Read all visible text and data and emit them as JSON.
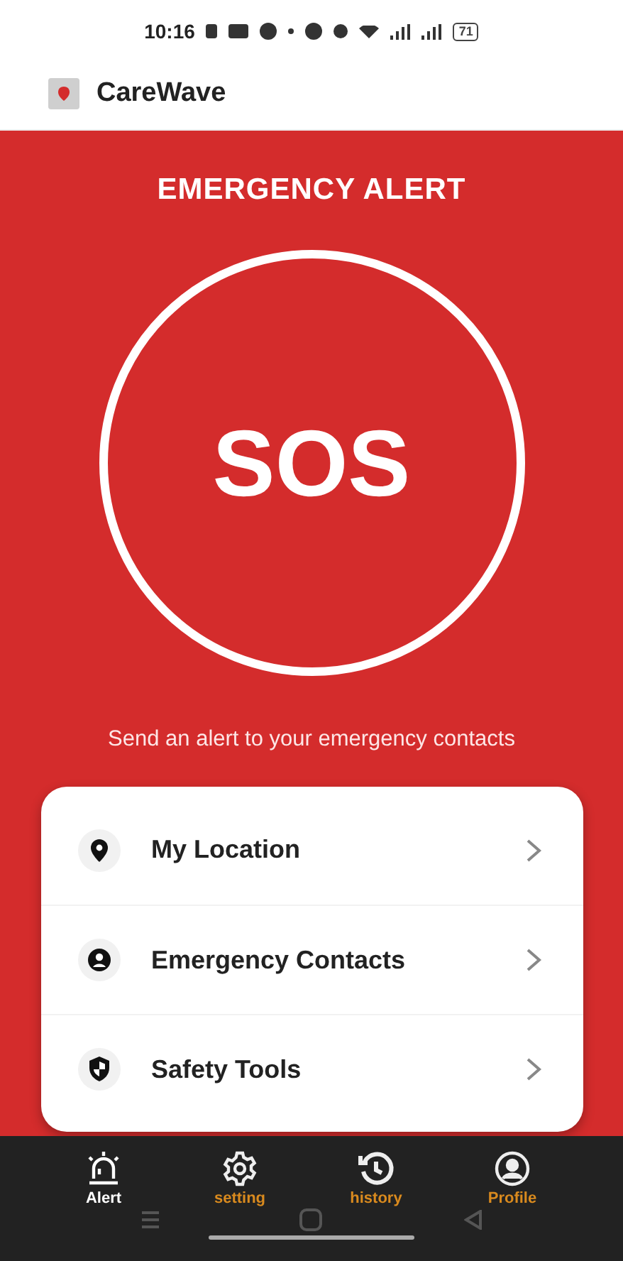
{
  "status_bar": {
    "time": "10:16",
    "battery": "71"
  },
  "app_bar": {
    "title": "CareWave"
  },
  "alert": {
    "title": "EMERGENCY ALERT",
    "button": "SOS",
    "caption": "Send an alert to your emergency contacts"
  },
  "menu": [
    {
      "kind": "location",
      "label": "My Location"
    },
    {
      "kind": "contacts",
      "label": "Emergency Contacts"
    },
    {
      "kind": "tools",
      "label": "Safety Tools"
    }
  ],
  "nav": [
    {
      "kind": "alert",
      "label": "Alert",
      "selected": true
    },
    {
      "kind": "setting",
      "label": "setting",
      "selected": false
    },
    {
      "kind": "history",
      "label": "history",
      "selected": false
    },
    {
      "kind": "profile",
      "label": "Profile",
      "selected": false
    }
  ]
}
